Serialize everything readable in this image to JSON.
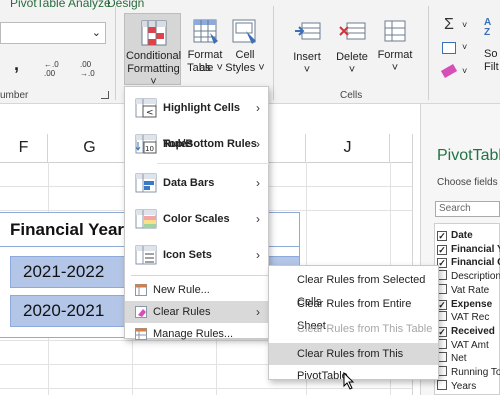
{
  "ribbon": {
    "tabs": [
      "PivotTable Analyze",
      "Design"
    ],
    "number_group_label": "umber",
    "cells_group_label": "Cells",
    "buttons": {
      "conditional_formatting": [
        "Conditional",
        "Formatting ˅"
      ],
      "format_as_table": [
        "Format as",
        "Table ˅"
      ],
      "cell_styles": [
        "Cell",
        "Styles ˅"
      ],
      "insert": [
        "Insert",
        "˅"
      ],
      "delete": [
        "Delete",
        "˅"
      ],
      "format": [
        "Format",
        "˅"
      ],
      "sort_filter": [
        "So",
        "Filt"
      ]
    },
    "number_symbols": {
      "comma": ",",
      "inc_decimal": "←.0 .00",
      "dec_decimal": ".00 →.0"
    }
  },
  "sheet": {
    "columns": [
      "F",
      "G",
      "H",
      "I",
      "J"
    ],
    "header_text": "Financial Year",
    "values": [
      "2021-2022",
      "2020-2021"
    ]
  },
  "pivot": {
    "title": "PivotTable",
    "subtitle": "Choose fields to",
    "search_placeholder": "Search",
    "fields": [
      {
        "label": "Date",
        "checked": true,
        "bold": true
      },
      {
        "label": "Financial Ye",
        "checked": true,
        "bold": true
      },
      {
        "label": "Financial Qt",
        "checked": true,
        "bold": true
      },
      {
        "label": "Description",
        "checked": false,
        "bold": false
      },
      {
        "label": "Vat Rate",
        "checked": false,
        "bold": false
      },
      {
        "label": "Expense",
        "checked": true,
        "bold": true
      },
      {
        "label": "VAT Rec",
        "checked": false,
        "bold": false
      },
      {
        "label": "Received",
        "checked": true,
        "bold": true
      },
      {
        "label": "VAT Amt",
        "checked": false,
        "bold": false
      },
      {
        "label": "Net",
        "checked": false,
        "bold": false
      },
      {
        "label": "Running Tot",
        "checked": false,
        "bold": false
      },
      {
        "label": "Years",
        "checked": false,
        "bold": false
      }
    ]
  },
  "menu": {
    "items": [
      {
        "label": "Highlight Cells Rules",
        "has_submenu": true
      },
      {
        "label": "Top/Bottom Rules",
        "has_submenu": true
      },
      {
        "label": "Data Bars",
        "has_submenu": true
      },
      {
        "label": "Color Scales",
        "has_submenu": true
      },
      {
        "label": "Icon Sets",
        "has_submenu": true
      }
    ],
    "small_items": [
      {
        "label": "New Rule..."
      },
      {
        "label": "Clear Rules",
        "has_submenu": true
      },
      {
        "label": "Manage Rules..."
      }
    ]
  },
  "submenu": {
    "items": [
      {
        "label": "Clear Rules from Selected Cells",
        "enabled": true
      },
      {
        "label": "Clear Rules from Entire Sheet",
        "enabled": true
      },
      {
        "label": "Clear Rules from This Table",
        "enabled": false
      },
      {
        "label": "Clear Rules from This PivotTable",
        "enabled": true
      }
    ]
  }
}
